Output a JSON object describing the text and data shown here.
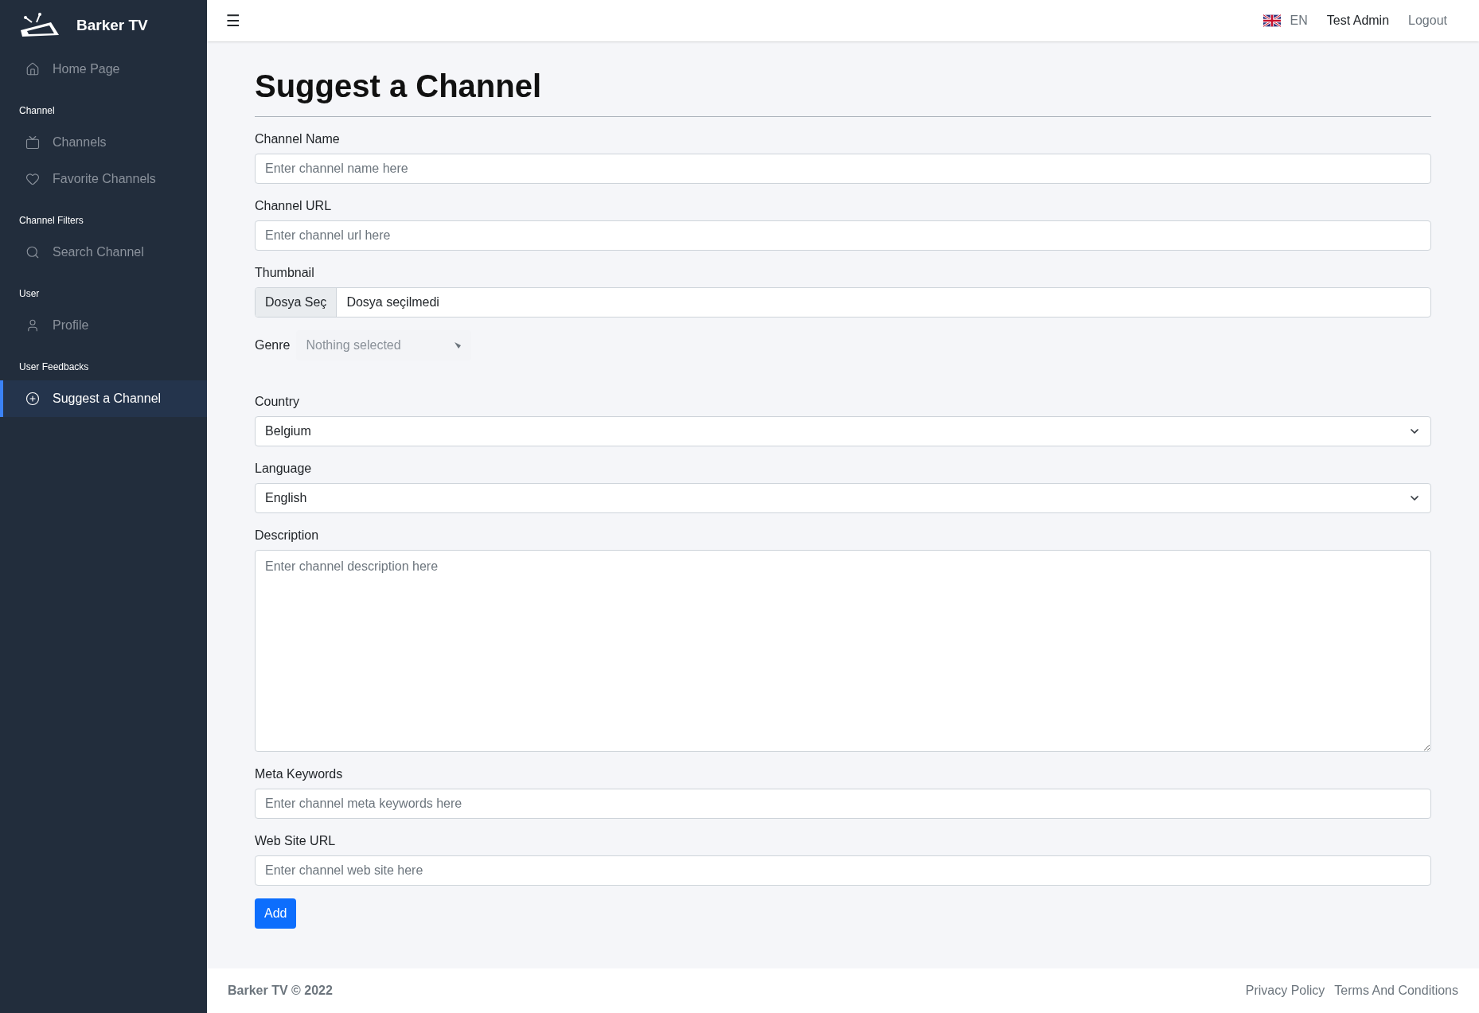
{
  "sidebar": {
    "brand": "Barker TV",
    "items": [
      {
        "kind": "link",
        "label": "Home Page",
        "selected": false
      },
      {
        "kind": "heading",
        "label": "Channel"
      },
      {
        "kind": "link",
        "label": "Channels",
        "selected": false
      },
      {
        "kind": "link",
        "label": "Favorite Channels",
        "selected": false
      },
      {
        "kind": "heading",
        "label": "Channel Filters"
      },
      {
        "kind": "link",
        "label": "Search Channel",
        "selected": false
      },
      {
        "kind": "heading",
        "label": "User"
      },
      {
        "kind": "link",
        "label": "Profile",
        "selected": false
      },
      {
        "kind": "heading",
        "label": "User Feedbacks"
      },
      {
        "kind": "link",
        "label": "Suggest a Channel",
        "selected": true
      }
    ]
  },
  "topbar": {
    "menu_icon": "☰",
    "language": "EN",
    "user": "Test Admin",
    "logout": "Logout"
  },
  "page": {
    "title": "Suggest a Channel",
    "fields": [
      {
        "kind": "text",
        "label": "Channel Name",
        "placeholder": "Enter channel name here"
      },
      {
        "kind": "text",
        "label": "Channel URL",
        "placeholder": "Enter channel url here"
      },
      {
        "kind": "file",
        "label": "Thumbnail",
        "button": "Dosya Seç",
        "value": "Dosya seçilmedi"
      },
      {
        "kind": "multiselect",
        "label": "Genre",
        "placeholder": "Nothing selected"
      },
      {
        "kind": "select",
        "label": "Country",
        "value": "Belgium"
      },
      {
        "kind": "select",
        "label": "Language",
        "value": "English"
      },
      {
        "kind": "textarea",
        "label": "Description",
        "placeholder": "Enter channel description here"
      },
      {
        "kind": "text",
        "label": "Meta Keywords",
        "placeholder": "Enter channel meta keywords here"
      },
      {
        "kind": "text",
        "label": "Web Site URL",
        "placeholder": "Enter channel web site here"
      }
    ],
    "submit": "Add"
  },
  "footer": {
    "copyright": "Barker TV © 2022",
    "links": [
      "Privacy Policy",
      "Terms And Conditions"
    ]
  }
}
